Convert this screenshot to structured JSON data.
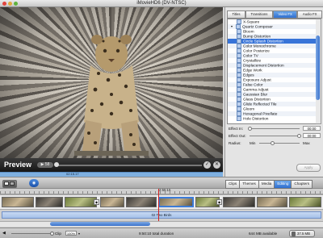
{
  "window": {
    "title": "iMovieHD6 (DV-NTSC)"
  },
  "preview": {
    "label": "Preview",
    "timecode": "0:59",
    "playhead_time": "02:15.17",
    "play_label": "▶ 58"
  },
  "pane_tabs": [
    "Titles",
    "Transitions",
    "Video FX",
    "Audio FX"
  ],
  "active_pane_tab": "Video FX",
  "effects": {
    "items": [
      {
        "label": "X-Square",
        "type": "item"
      },
      {
        "label": "Quartz Composer",
        "type": "group"
      },
      {
        "label": "Bloom",
        "type": "item"
      },
      {
        "label": "Bump Distortion",
        "type": "item"
      },
      {
        "label": "Circle Splash Distortion",
        "type": "item",
        "selected": true
      },
      {
        "label": "Color Monochrome",
        "type": "item"
      },
      {
        "label": "Color Posterize",
        "type": "item"
      },
      {
        "label": "Color TV",
        "type": "item"
      },
      {
        "label": "Crystallize",
        "type": "item"
      },
      {
        "label": "Displacement Distortion",
        "type": "item"
      },
      {
        "label": "Edge Work",
        "type": "item"
      },
      {
        "label": "Edges",
        "type": "item"
      },
      {
        "label": "Exposure Adjust",
        "type": "item"
      },
      {
        "label": "False Color",
        "type": "item"
      },
      {
        "label": "Gamma Adjust",
        "type": "item"
      },
      {
        "label": "Gaussian Blur",
        "type": "item"
      },
      {
        "label": "Glass Distortion",
        "type": "item"
      },
      {
        "label": "Glide Reflected Tile",
        "type": "item"
      },
      {
        "label": "Gloom",
        "type": "item"
      },
      {
        "label": "Hexagonal Pixellate",
        "type": "item"
      },
      {
        "label": "Hole Distortion",
        "type": "item"
      }
    ]
  },
  "sliders": {
    "effect_in": {
      "label": "Effect In:",
      "value": "00:00"
    },
    "effect_out": {
      "label": "Effect Out:",
      "value": "00:00"
    },
    "radius": {
      "label": "Radius:",
      "min_label": "Min",
      "max_label": "Max"
    }
  },
  "apply_label": "Apply",
  "project_tabs": [
    "Clips",
    "Themes",
    "Media",
    "Editing",
    "Chapters"
  ],
  "active_project_tab": "Editing",
  "timeline": {
    "playhead_label": "2:55:15",
    "audio_clip_label": "02 Two Birds"
  },
  "status": {
    "clip_label": "Clip",
    "clip_value": "100%",
    "duration_text": "9:50:10 total duration",
    "disk_text": "644 MB available",
    "trash_label": "37.5 MB"
  },
  "colors": {
    "accent": "#3874d8",
    "selection": "#3874d8",
    "playhead": "#d02020"
  }
}
